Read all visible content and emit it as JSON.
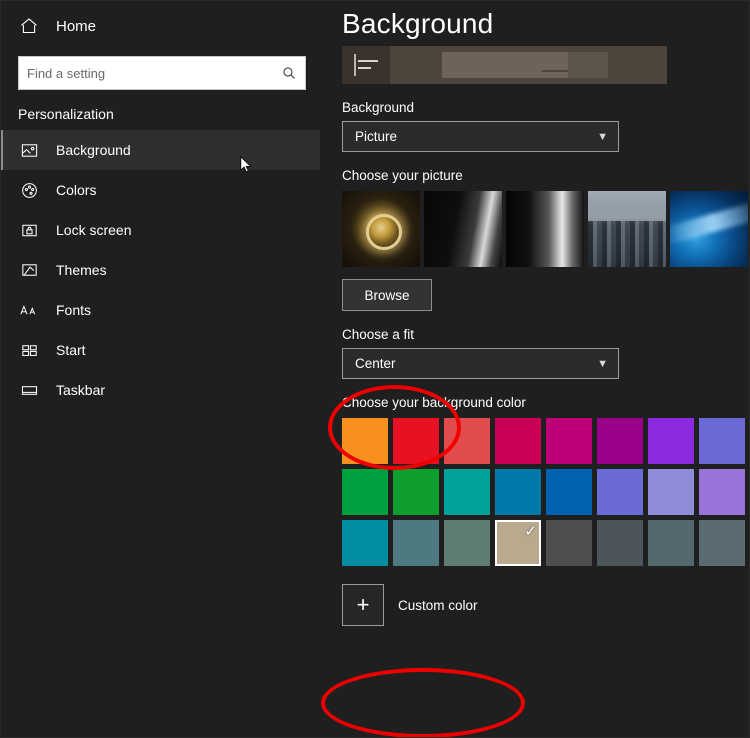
{
  "sidebar": {
    "home": {
      "label": "Home",
      "icon": "home-icon"
    },
    "search": {
      "placeholder": "Find a setting",
      "value": "",
      "icon": "search-icon"
    },
    "section_title": "Personalization",
    "items": [
      {
        "label": "Background",
        "icon": "picture-icon",
        "selected": true
      },
      {
        "label": "Colors",
        "icon": "color-wheel-icon",
        "selected": false
      },
      {
        "label": "Lock screen",
        "icon": "lock-screen-icon",
        "selected": false
      },
      {
        "label": "Themes",
        "icon": "brush-icon",
        "selected": false
      },
      {
        "label": "Fonts",
        "icon": "fonts-icon",
        "selected": false
      },
      {
        "label": "Start",
        "icon": "start-tiles-icon",
        "selected": false
      },
      {
        "label": "Taskbar",
        "icon": "taskbar-icon",
        "selected": false
      }
    ],
    "cursor": {
      "icon": "mouse-pointer-icon"
    }
  },
  "main": {
    "title": "Background",
    "preview_alt": "desktop-preview",
    "background": {
      "label": "Background",
      "selected": "Picture",
      "chevron": "▼"
    },
    "choose_picture": {
      "label": "Choose your picture",
      "thumbnails": [
        "picture-thumb-glow-ring",
        "picture-thumb-dark-light-1",
        "picture-thumb-dark-light-2",
        "picture-thumb-cityscape",
        "picture-thumb-windows-blue"
      ],
      "browse_label": "Browse"
    },
    "choose_fit": {
      "label": "Choose a fit",
      "selected": "Center",
      "chevron": "▼"
    },
    "background_color": {
      "label": "Choose your background color",
      "rows": [
        [
          "#f7901e",
          "#e81123",
          "#e14b4b",
          "#c90054",
          "#bf0077",
          "#9a0089",
          "#8a2be2",
          "#6b69d6"
        ],
        [
          "#00a03e",
          "#0f9d2f",
          "#00a19b",
          "#0078a8",
          "#0063b1",
          "#6b6bd6",
          "#8e8cd8",
          "#9a73d8"
        ],
        [
          "#018ea3",
          "#4c7a80",
          "#5f7d72",
          "#b8a98f",
          "#4f4f4f",
          "#4a5459",
          "#55676e",
          "#5a6b72"
        ]
      ],
      "selected_index": {
        "row": 2,
        "col": 3
      },
      "selected_check": "✓"
    },
    "custom_color": {
      "label": "Custom color",
      "plus": "+"
    }
  },
  "annotations": [
    {
      "name": "highlight-choose-a-fit",
      "color": "#ee0000"
    },
    {
      "name": "highlight-custom-color",
      "color": "#ee0000"
    }
  ]
}
